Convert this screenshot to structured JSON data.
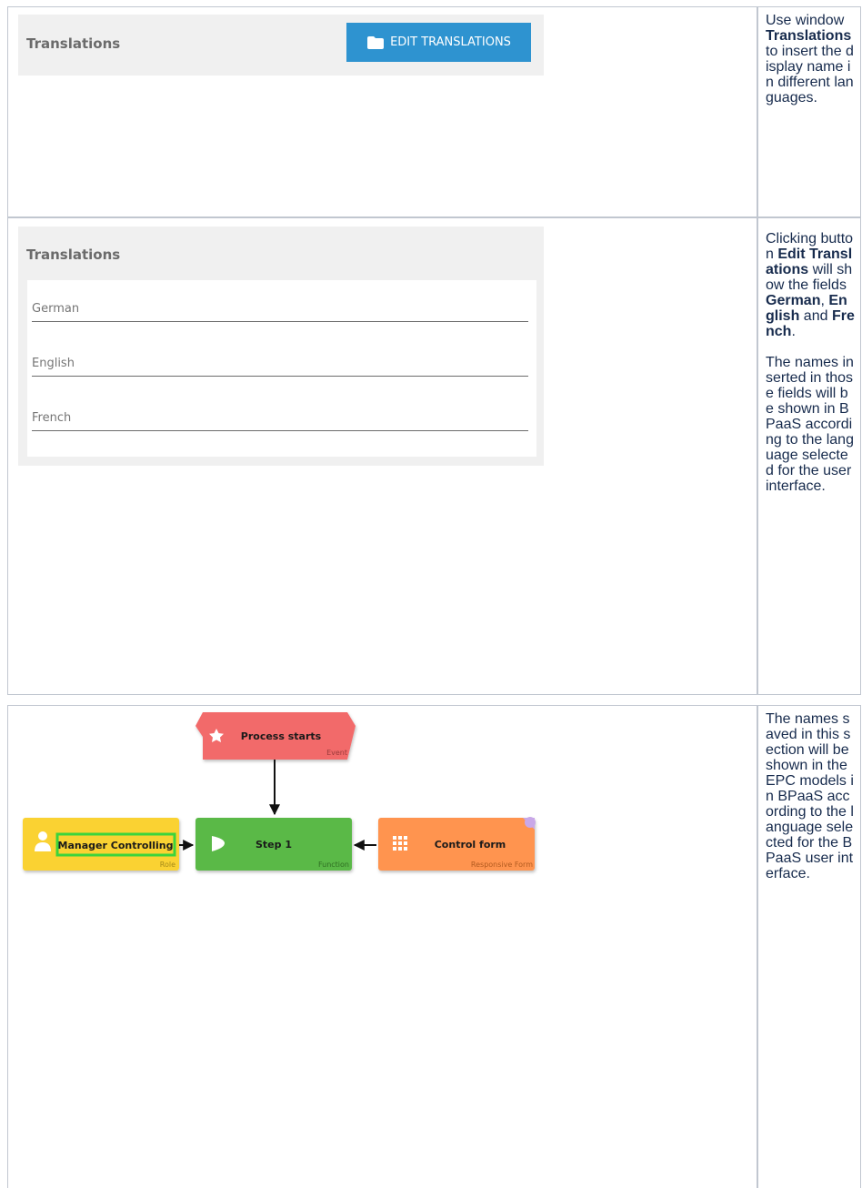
{
  "section1": {
    "row1": {
      "panel_title": "Translations",
      "edit_button_label": "EDIT TRANSLATIONS",
      "description_parts": [
        {
          "text": "Use window ",
          "bold": false
        },
        {
          "text": "Translations",
          "bold": true
        },
        {
          "text": " to insert the display name in different languages.",
          "bold": false
        }
      ]
    },
    "row2": {
      "panel_title": "Translations",
      "fields": [
        {
          "placeholder": "German"
        },
        {
          "placeholder": "English"
        },
        {
          "placeholder": "French"
        }
      ],
      "description_parts": [
        {
          "text": "Clicking button ",
          "bold": false
        },
        {
          "text": "Edit Translations",
          "bold": true
        },
        {
          "text": " will show the fields ",
          "bold": false
        },
        {
          "text": "German",
          "bold": true
        },
        {
          "text": ", ",
          "bold": false
        },
        {
          "text": "English",
          "bold": true
        },
        {
          "text": " and ",
          "bold": false
        },
        {
          "text": "French",
          "bold": true
        },
        {
          "text": ".",
          "bold": false
        }
      ],
      "description_para2": "The names inserted in those fields will be shown in BPaaS according to the language selected for the user interface."
    }
  },
  "section2": {
    "diagram": {
      "event": {
        "label": "Process starts",
        "type": "Event",
        "color": "#f26b6b"
      },
      "role": {
        "label": "Manager Controlling",
        "type": "Role",
        "color": "#fad233",
        "highlight": "#3cd43c"
      },
      "function": {
        "label": "Step 1",
        "type": "Function",
        "color": "#5ab947"
      },
      "form": {
        "label": "Control form",
        "type": "Responsive Form",
        "color": "#ff9450"
      }
    },
    "description": "The names saved in this section will be shown in the EPC models in BPaaS according to the language selected for the BPaaS user interface."
  },
  "colors": {
    "button": "#2e93d0",
    "border": "#c1c7d0",
    "panel_bg": "#f0f0f0"
  }
}
